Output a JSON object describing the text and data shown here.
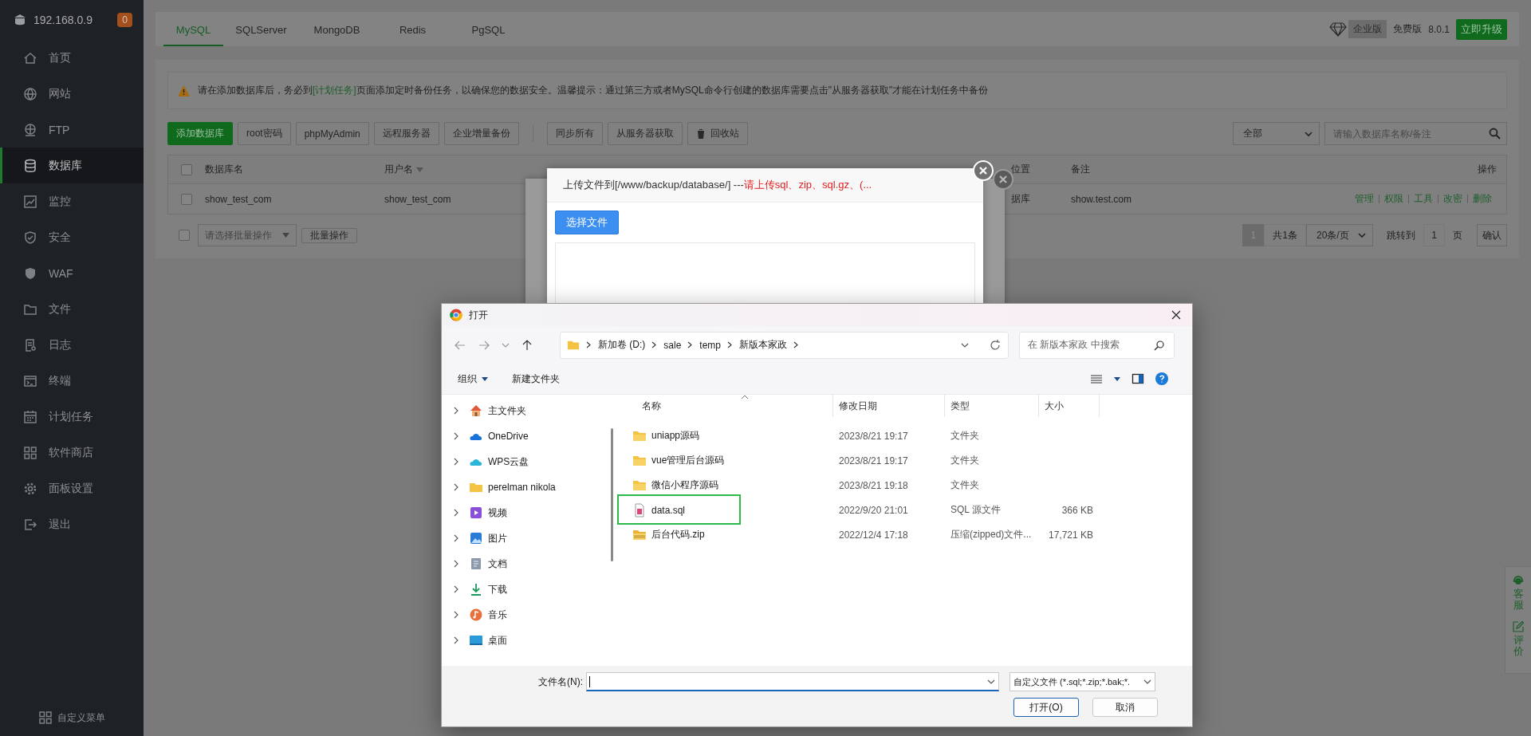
{
  "sidebar": {
    "host": "192.168.0.9",
    "badge": "0",
    "items": [
      {
        "label": "首页",
        "selected": false
      },
      {
        "label": "网站",
        "selected": false
      },
      {
        "label": "FTP",
        "selected": false
      },
      {
        "label": "数据库",
        "selected": true
      },
      {
        "label": "监控",
        "selected": false
      },
      {
        "label": "安全",
        "selected": false
      },
      {
        "label": "WAF",
        "selected": false
      },
      {
        "label": "文件",
        "selected": false
      },
      {
        "label": "日志",
        "selected": false
      },
      {
        "label": "终端",
        "selected": false
      },
      {
        "label": "计划任务",
        "selected": false
      },
      {
        "label": "软件商店",
        "selected": false
      },
      {
        "label": "面板设置",
        "selected": false
      },
      {
        "label": "退出",
        "selected": false
      }
    ],
    "footer": "自定义菜单"
  },
  "header": {
    "tabs": [
      {
        "label": "MySQL",
        "selected": true
      },
      {
        "label": "SQLServer",
        "selected": false
      },
      {
        "label": "MongoDB",
        "selected": false
      },
      {
        "label": "Redis",
        "selected": false
      },
      {
        "label": "PgSQL",
        "selected": false
      }
    ],
    "edition": "企业版",
    "plan": "免费版",
    "version": "8.0.1",
    "upgrade": "立即升级"
  },
  "alert": {
    "before": "请在添加数据库后，务必到",
    "link": "[计划任务]",
    "after": "页面添加定时备份任务，以确保您的数据安全。温馨提示：通过第三方或者MySQL命令行创建的数据库需要点击\"从服务器获取\"才能在计划任务中备份"
  },
  "toolbar": {
    "left": [
      {
        "label": "添加数据库",
        "kind": "primary"
      },
      {
        "label": "root密码",
        "kind": "plain"
      },
      {
        "label": "phpMyAdmin",
        "kind": "plain"
      },
      {
        "label": "远程服务器",
        "kind": "plain"
      },
      {
        "label": "企业增量备份",
        "kind": "plain"
      }
    ],
    "right": [
      {
        "label": "同步所有",
        "kind": "plain"
      },
      {
        "label": "从服务器获取",
        "kind": "plain"
      },
      {
        "label": "回收站",
        "kind": "trash"
      }
    ],
    "filter": "全部",
    "search_placeholder": "请输入数据库名称/备注"
  },
  "table": {
    "select_all": false,
    "columns": [
      {
        "label": "数据库名",
        "sortable": false
      },
      {
        "label": "用户名",
        "sortable": true
      },
      {
        "label": "位置",
        "sortable": false
      },
      {
        "label": "备注",
        "sortable": false
      },
      {
        "label": "操作",
        "sortable": false
      }
    ],
    "rows": [
      {
        "checked": false,
        "cells": [
          "show_test_com",
          "show_test_com",
          "据库",
          "show.test.com"
        ],
        "actions": [
          "管理",
          "权限",
          "工具",
          "改密",
          "删除"
        ]
      }
    ]
  },
  "footer": {
    "batch_checked": false,
    "batch_placeholder": "请选择批量操作",
    "batch_button": "批量操作",
    "pages": [
      {
        "label": "1",
        "selected": true
      }
    ],
    "total": "共1条",
    "page_size": "20条/页",
    "jump_label": "跳转到",
    "jump_value": "1",
    "page_unit": "页",
    "confirm": "确认"
  },
  "upload_modal": {
    "title": "上传文件到[/www/backup/database/] --- ",
    "hint": "请上传sql、zip、sql.gz、(...",
    "button": "选择文件"
  },
  "file_dialog": {
    "title": "打开",
    "path": [
      "新加卷 (D:)",
      "sale",
      "temp",
      "新版本家政"
    ],
    "search_placeholder": "在 新版本家政 中搜索",
    "organize": "组织",
    "new_folder": "新建文件夹",
    "nav": [
      {
        "label": "主文件夹"
      },
      {
        "label": "OneDrive"
      },
      {
        "label": "WPS云盘"
      },
      {
        "label": "perelman nikola"
      },
      {
        "label": "视频"
      },
      {
        "label": "图片"
      },
      {
        "label": "文档"
      },
      {
        "label": "下载"
      },
      {
        "label": "音乐"
      },
      {
        "label": "桌面"
      }
    ],
    "columns": [
      "名称",
      "修改日期",
      "类型",
      "大小"
    ],
    "files": [
      {
        "name": "uniapp源码",
        "date": "2023/8/21 19:17",
        "type": "文件夹",
        "kind": "folder",
        "highlighted": false
      },
      {
        "name": "vue管理后台源码",
        "date": "2023/8/21 19:17",
        "type": "文件夹",
        "kind": "folder",
        "highlighted": false
      },
      {
        "name": "微信小程序源码",
        "date": "2023/8/21 19:18",
        "type": "文件夹",
        "kind": "folder",
        "highlighted": false
      },
      {
        "name": "data.sql",
        "date": "2022/9/20 21:01",
        "type": "SQL 源文件",
        "size": "366 KB",
        "kind": "sql",
        "highlighted": true
      },
      {
        "name": "后台代码.zip",
        "date": "2022/12/4 17:18",
        "type": "压缩(zipped)文件...",
        "size": "17,721 KB",
        "kind": "zip",
        "highlighted": false
      }
    ],
    "filename_label": "文件名(N):",
    "filter": "自定义文件 (*.sql;*.zip;*.bak;*.",
    "open": "打开(O)",
    "cancel": "取消"
  },
  "side_widget": [
    {
      "label": "客服"
    },
    {
      "label": "评价"
    }
  ]
}
